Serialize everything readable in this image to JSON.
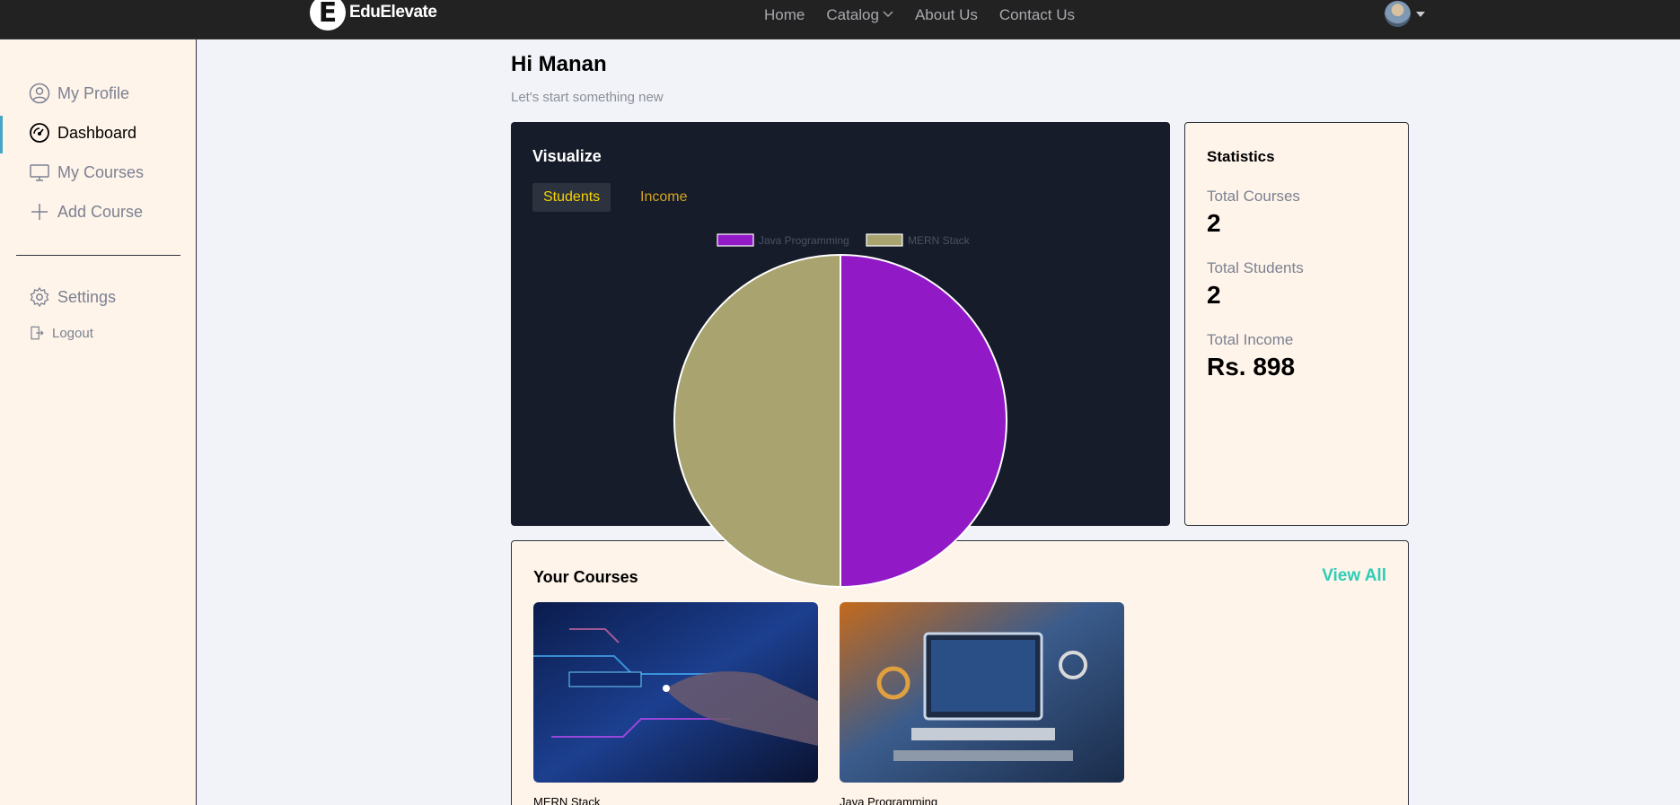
{
  "brand": {
    "logo_letter": "E",
    "name": "EduElevate"
  },
  "nav": {
    "links": [
      "Home",
      "Catalog",
      "About Us",
      "Contact Us"
    ]
  },
  "sidebar": {
    "items": [
      {
        "label": "My Profile",
        "icon": "user-circle-icon",
        "active": false
      },
      {
        "label": "Dashboard",
        "icon": "gauge-icon",
        "active": true
      },
      {
        "label": "My Courses",
        "icon": "monitor-icon",
        "active": false
      },
      {
        "label": "Add Course",
        "icon": "plus-icon",
        "active": false
      }
    ],
    "settings_label": "Settings",
    "logout_label": "Logout"
  },
  "greeting": {
    "title": "Hi Manan",
    "subtitle": "Let's start something new"
  },
  "visualize": {
    "title": "Visualize",
    "tabs": [
      "Students",
      "Income"
    ],
    "active_tab": "Students"
  },
  "chart_data": {
    "type": "pie",
    "labels": [
      "Java Programming",
      "MERN Stack"
    ],
    "values": [
      1,
      1
    ],
    "colors": [
      "#9219c6",
      "#a9a36f"
    ],
    "legend": "top"
  },
  "statistics": {
    "title": "Statistics",
    "total_courses_label": "Total Courses",
    "total_courses": "2",
    "total_students_label": "Total Students",
    "total_students": "2",
    "total_income_label": "Total Income",
    "total_income": "Rs. 898"
  },
  "courses": {
    "title": "Your Courses",
    "view_all": "View All",
    "items": [
      {
        "name": "MERN Stack"
      },
      {
        "name": "Java Programming"
      }
    ]
  },
  "colors": {
    "accent": "#2ecdb6",
    "tab_active": "#f5d200",
    "dark_card": "#161c29"
  }
}
